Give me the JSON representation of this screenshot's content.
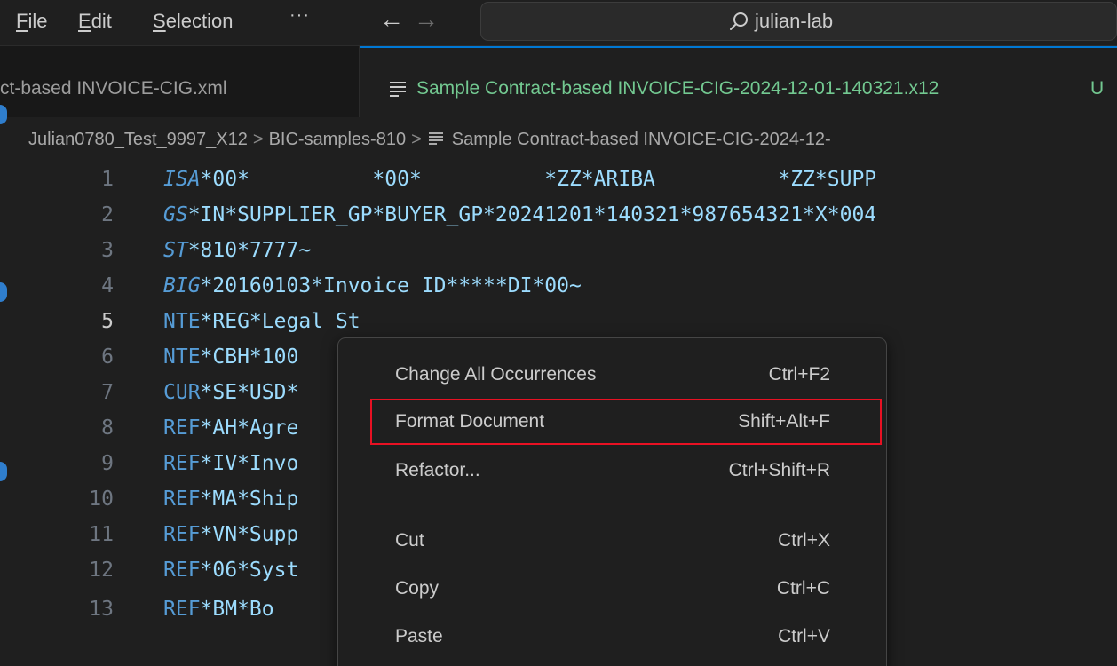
{
  "titlebar": {
    "menus": [
      {
        "mnemonic": "F",
        "rest": "ile"
      },
      {
        "mnemonic": "E",
        "rest": "dit"
      },
      {
        "mnemonic": "S",
        "rest": "election"
      }
    ],
    "more": "···",
    "back_arrow": "←",
    "forward_arrow": "→",
    "search_text": "julian-lab"
  },
  "tabs": [
    {
      "label": "ct-based INVOICE-CIG.xml",
      "active": false
    },
    {
      "label": "Sample Contract-based INVOICE-CIG-2024-12-01-140321.x12",
      "badge": "U",
      "active": true
    }
  ],
  "breadcrumb": {
    "items": [
      "Julian0780_Test_9997_X12",
      "BIC-samples-810",
      "Sample Contract-based INVOICE-CIG-2024-12-"
    ],
    "separator": ">"
  },
  "editor": {
    "active_line": "5",
    "lines": [
      {
        "num": "1",
        "seg": "ISA",
        "rest": "*00*          *00*          *ZZ*ARIBA          *ZZ*SUPP",
        "italic": true
      },
      {
        "num": "2",
        "seg": "GS",
        "rest": "*IN*SUPPLIER_GP*BUYER_GP*20241201*140321*987654321*X*004",
        "italic": true
      },
      {
        "num": "3",
        "seg": "ST",
        "rest": "*810*7777~",
        "italic": true
      },
      {
        "num": "4",
        "seg": "BIG",
        "rest": "*20160103*Invoice ID*****DI*00~",
        "italic": true
      },
      {
        "num": "5",
        "seg": "NTE",
        "rest": "*REG*Legal St",
        "italic": false
      },
      {
        "num": "6",
        "seg": "NTE",
        "rest": "*CBH*100",
        "italic": false
      },
      {
        "num": "7",
        "seg": "CUR",
        "rest": "*SE*USD*",
        "italic": false
      },
      {
        "num": "8",
        "seg": "REF",
        "rest": "*AH*Agre",
        "italic": false
      },
      {
        "num": "9",
        "seg": "REF",
        "rest": "*IV*Invo",
        "italic": false
      },
      {
        "num": "10",
        "seg": "REF",
        "rest": "*MA*Ship",
        "italic": false
      },
      {
        "num": "11",
        "seg": "REF",
        "rest": "*VN*Supp",
        "italic": false
      },
      {
        "num": "12",
        "seg": "REF",
        "rest": "*06*Syst",
        "italic": false
      },
      {
        "num": "13",
        "seg": "REF",
        "rest": "*BM*Bo",
        "italic": false
      }
    ]
  },
  "context_menu": {
    "items": [
      {
        "label": "Change All Occurrences",
        "shortcut": "Ctrl+F2"
      },
      {
        "label": "Format Document",
        "shortcut": "Shift+Alt+F",
        "highlighted": true
      },
      {
        "label": "Refactor...",
        "shortcut": "Ctrl+Shift+R"
      },
      {
        "label": "Cut",
        "shortcut": "Ctrl+X"
      },
      {
        "label": "Copy",
        "shortcut": "Ctrl+C"
      },
      {
        "label": "Paste",
        "shortcut": "Ctrl+V"
      }
    ]
  },
  "colors": {
    "background": "#1f1f1f",
    "tab_active_text": "#73c991",
    "accent": "#0078d4",
    "highlight_outline": "#e81123",
    "keyword": "#569cd6",
    "identifier": "#9cdcfe",
    "number": "#b5cea8"
  }
}
